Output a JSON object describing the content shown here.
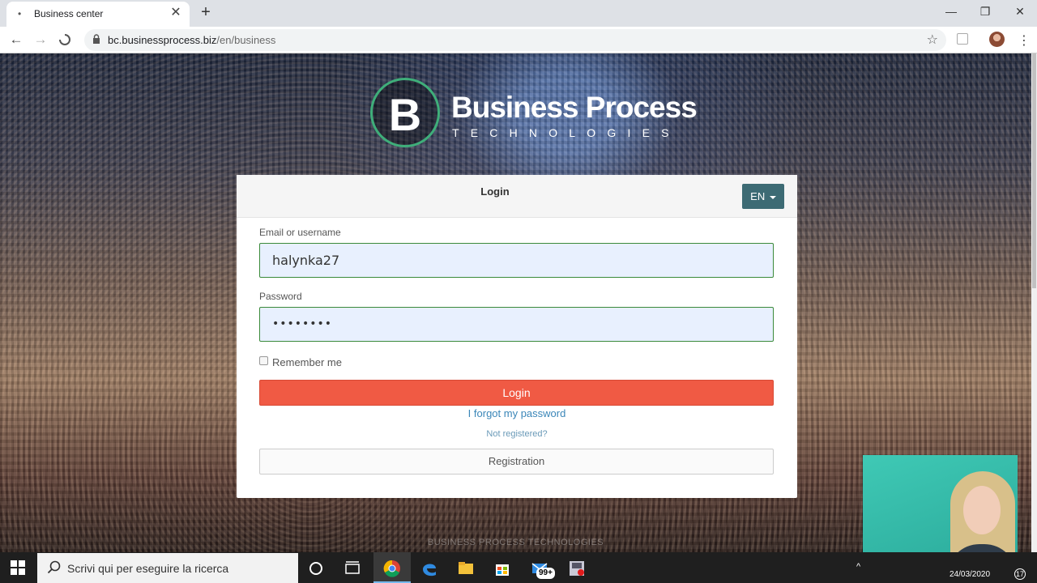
{
  "browser": {
    "tab_title": "Business center",
    "url_host": "bc.businessprocess.biz",
    "url_path": "/en/business"
  },
  "logo": {
    "mark": "B",
    "name": "Business Process",
    "subtitle": "TECHNOLOGIES"
  },
  "login_card": {
    "title": "Login",
    "language": "EN",
    "email_label": "Email or username",
    "email_value": "halynka27",
    "password_label": "Password",
    "password_value": "••••••••",
    "remember_label": "Remember me",
    "login_button": "Login",
    "forgot_link": "I forgot my password",
    "not_registered": "Not registered?",
    "registration_button": "Registration"
  },
  "footer": {
    "text": "BUSINESS PROCESS TECHNOLOGIES"
  },
  "taskbar": {
    "search_placeholder": "Scrivi qui per eseguire la ricerca",
    "mail_badge": "99+",
    "date": "24/03/2020",
    "notification_count": "17"
  },
  "colors": {
    "login_button": "#f05a44",
    "lang_button": "#3d6b74",
    "logo_ring": "#3fae7a",
    "link": "#3a86b8"
  }
}
